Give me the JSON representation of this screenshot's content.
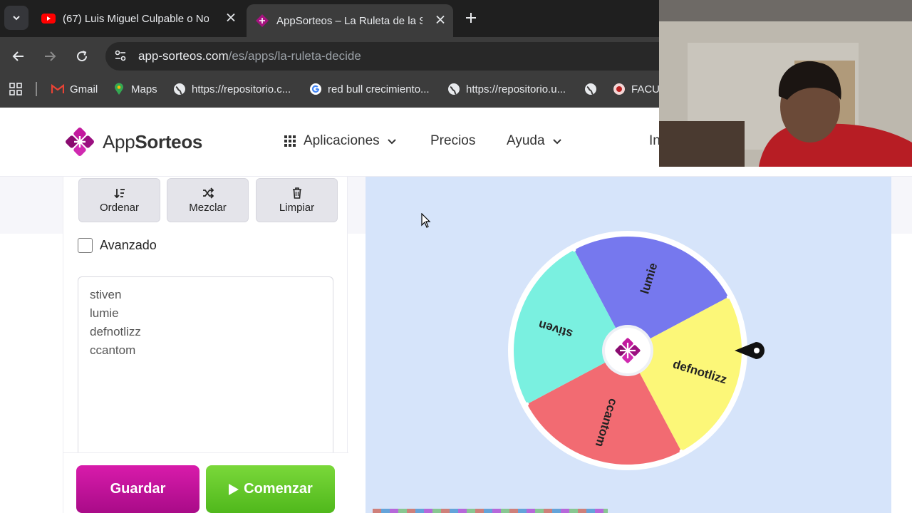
{
  "browser": {
    "tabs": [
      {
        "title": "(67) Luis Miguel Culpable o No",
        "icon": "youtube-icon"
      },
      {
        "title": "AppSorteos – La Ruleta de la Suerte",
        "icon": "appsorteos-icon"
      }
    ],
    "url_host": "app-sorteos.com",
    "url_path": "/es/apps/la-ruleta-decide",
    "bookmarks": [
      "Gmail",
      "Maps",
      "https://repositorio.c...",
      "red bull crecimiento...",
      "https://repositorio.u...",
      "",
      "FACU"
    ]
  },
  "header": {
    "brand_light": "App",
    "brand_bold": "Sorteos",
    "nav": {
      "apps": "Aplicaciones",
      "pricing": "Precios",
      "help": "Ayuda",
      "login_partial": "In"
    }
  },
  "panel": {
    "sort": "Ordenar",
    "shuffle": "Mezclar",
    "clear": "Limpiar",
    "advanced": "Avanzado",
    "entries": [
      "stiven",
      "lumie",
      "defnotlizz",
      "ccantom"
    ],
    "save": "Guardar",
    "start": "Comenzar"
  },
  "wheel": {
    "segments": [
      {
        "label": "lumie",
        "color": "#7678ee"
      },
      {
        "label": "defnotlizz",
        "color": "#fcf778"
      },
      {
        "label": "ccantom",
        "color": "#f26b72"
      },
      {
        "label": "stiven",
        "color": "#7af0e0"
      }
    ],
    "accent": "#a5127f"
  }
}
